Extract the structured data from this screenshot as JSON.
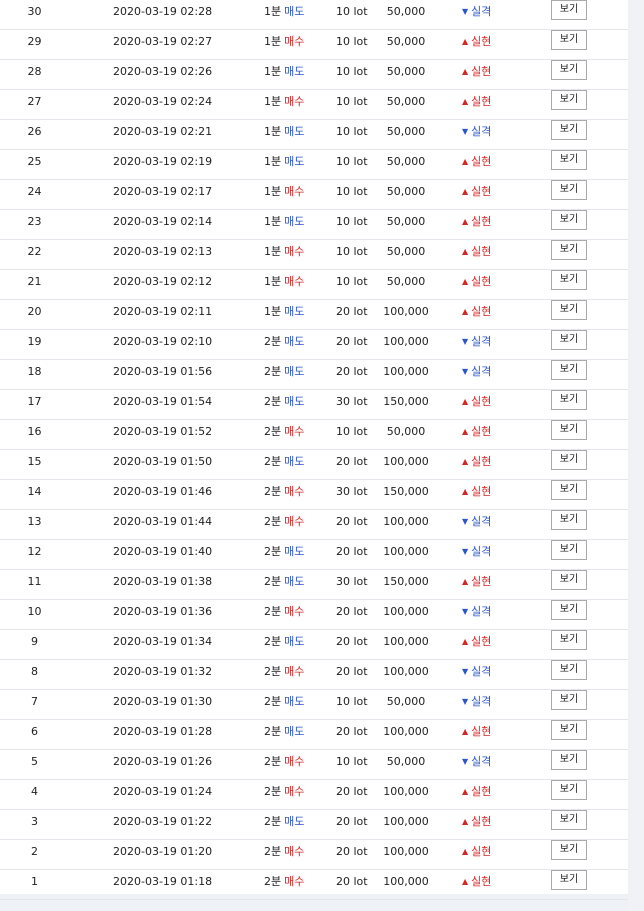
{
  "rows": [
    {
      "no": "30",
      "time": "2020-03-19 02:28",
      "dur": "1분",
      "side": "매도",
      "lot": "10 lot",
      "amount": "50,000",
      "result": "실격",
      "btn": "보기"
    },
    {
      "no": "29",
      "time": "2020-03-19 02:27",
      "dur": "1분",
      "side": "매수",
      "lot": "10 lot",
      "amount": "50,000",
      "result": "실현",
      "btn": "보기"
    },
    {
      "no": "28",
      "time": "2020-03-19 02:26",
      "dur": "1분",
      "side": "매도",
      "lot": "10 lot",
      "amount": "50,000",
      "result": "실현",
      "btn": "보기"
    },
    {
      "no": "27",
      "time": "2020-03-19 02:24",
      "dur": "1분",
      "side": "매수",
      "lot": "10 lot",
      "amount": "50,000",
      "result": "실현",
      "btn": "보기"
    },
    {
      "no": "26",
      "time": "2020-03-19 02:21",
      "dur": "1분",
      "side": "매도",
      "lot": "10 lot",
      "amount": "50,000",
      "result": "실격",
      "btn": "보기"
    },
    {
      "no": "25",
      "time": "2020-03-19 02:19",
      "dur": "1분",
      "side": "매도",
      "lot": "10 lot",
      "amount": "50,000",
      "result": "실현",
      "btn": "보기"
    },
    {
      "no": "24",
      "time": "2020-03-19 02:17",
      "dur": "1분",
      "side": "매수",
      "lot": "10 lot",
      "amount": "50,000",
      "result": "실현",
      "btn": "보기"
    },
    {
      "no": "23",
      "time": "2020-03-19 02:14",
      "dur": "1분",
      "side": "매도",
      "lot": "10 lot",
      "amount": "50,000",
      "result": "실현",
      "btn": "보기"
    },
    {
      "no": "22",
      "time": "2020-03-19 02:13",
      "dur": "1분",
      "side": "매수",
      "lot": "10 lot",
      "amount": "50,000",
      "result": "실현",
      "btn": "보기"
    },
    {
      "no": "21",
      "time": "2020-03-19 02:12",
      "dur": "1분",
      "side": "매수",
      "lot": "10 lot",
      "amount": "50,000",
      "result": "실현",
      "btn": "보기"
    },
    {
      "no": "20",
      "time": "2020-03-19 02:11",
      "dur": "1분",
      "side": "매도",
      "lot": "20 lot",
      "amount": "100,000",
      "result": "실현",
      "btn": "보기"
    },
    {
      "no": "19",
      "time": "2020-03-19 02:10",
      "dur": "2분",
      "side": "매도",
      "lot": "20 lot",
      "amount": "100,000",
      "result": "실격",
      "btn": "보기"
    },
    {
      "no": "18",
      "time": "2020-03-19 01:56",
      "dur": "2분",
      "side": "매도",
      "lot": "20 lot",
      "amount": "100,000",
      "result": "실격",
      "btn": "보기"
    },
    {
      "no": "17",
      "time": "2020-03-19 01:54",
      "dur": "2분",
      "side": "매도",
      "lot": "30 lot",
      "amount": "150,000",
      "result": "실현",
      "btn": "보기"
    },
    {
      "no": "16",
      "time": "2020-03-19 01:52",
      "dur": "2분",
      "side": "매수",
      "lot": "10 lot",
      "amount": "50,000",
      "result": "실현",
      "btn": "보기"
    },
    {
      "no": "15",
      "time": "2020-03-19 01:50",
      "dur": "2분",
      "side": "매도",
      "lot": "20 lot",
      "amount": "100,000",
      "result": "실현",
      "btn": "보기"
    },
    {
      "no": "14",
      "time": "2020-03-19 01:46",
      "dur": "2분",
      "side": "매수",
      "lot": "30 lot",
      "amount": "150,000",
      "result": "실현",
      "btn": "보기"
    },
    {
      "no": "13",
      "time": "2020-03-19 01:44",
      "dur": "2분",
      "side": "매수",
      "lot": "20 lot",
      "amount": "100,000",
      "result": "실격",
      "btn": "보기"
    },
    {
      "no": "12",
      "time": "2020-03-19 01:40",
      "dur": "2분",
      "side": "매도",
      "lot": "20 lot",
      "amount": "100,000",
      "result": "실격",
      "btn": "보기"
    },
    {
      "no": "11",
      "time": "2020-03-19 01:38",
      "dur": "2분",
      "side": "매도",
      "lot": "30 lot",
      "amount": "150,000",
      "result": "실현",
      "btn": "보기"
    },
    {
      "no": "10",
      "time": "2020-03-19 01:36",
      "dur": "2분",
      "side": "매수",
      "lot": "20 lot",
      "amount": "100,000",
      "result": "실격",
      "btn": "보기"
    },
    {
      "no": "9",
      "time": "2020-03-19 01:34",
      "dur": "2분",
      "side": "매도",
      "lot": "20 lot",
      "amount": "100,000",
      "result": "실현",
      "btn": "보기"
    },
    {
      "no": "8",
      "time": "2020-03-19 01:32",
      "dur": "2분",
      "side": "매수",
      "lot": "20 lot",
      "amount": "100,000",
      "result": "실격",
      "btn": "보기"
    },
    {
      "no": "7",
      "time": "2020-03-19 01:30",
      "dur": "2분",
      "side": "매도",
      "lot": "10 lot",
      "amount": "50,000",
      "result": "실격",
      "btn": "보기"
    },
    {
      "no": "6",
      "time": "2020-03-19 01:28",
      "dur": "2분",
      "side": "매도",
      "lot": "20 lot",
      "amount": "100,000",
      "result": "실현",
      "btn": "보기"
    },
    {
      "no": "5",
      "time": "2020-03-19 01:26",
      "dur": "2분",
      "side": "매수",
      "lot": "10 lot",
      "amount": "50,000",
      "result": "실격",
      "btn": "보기"
    },
    {
      "no": "4",
      "time": "2020-03-19 01:24",
      "dur": "2분",
      "side": "매수",
      "lot": "20 lot",
      "amount": "100,000",
      "result": "실현",
      "btn": "보기"
    },
    {
      "no": "3",
      "time": "2020-03-19 01:22",
      "dur": "2분",
      "side": "매도",
      "lot": "20 lot",
      "amount": "100,000",
      "result": "실현",
      "btn": "보기"
    },
    {
      "no": "2",
      "time": "2020-03-19 01:20",
      "dur": "2분",
      "side": "매수",
      "lot": "20 lot",
      "amount": "100,000",
      "result": "실현",
      "btn": "보기"
    },
    {
      "no": "1",
      "time": "2020-03-19 01:18",
      "dur": "2분",
      "side": "매수",
      "lot": "20 lot",
      "amount": "100,000",
      "result": "실현",
      "btn": "보기"
    }
  ],
  "colors": {
    "sell": "#2c56c8",
    "buy": "#d42626",
    "result_realized": "#d42626",
    "result_failed": "#2c56c8"
  },
  "icons": {
    "realized": "triangle-up-icon",
    "failed": "triangle-down-icon"
  },
  "glyphs": {
    "up": "▲",
    "down": "▼"
  }
}
